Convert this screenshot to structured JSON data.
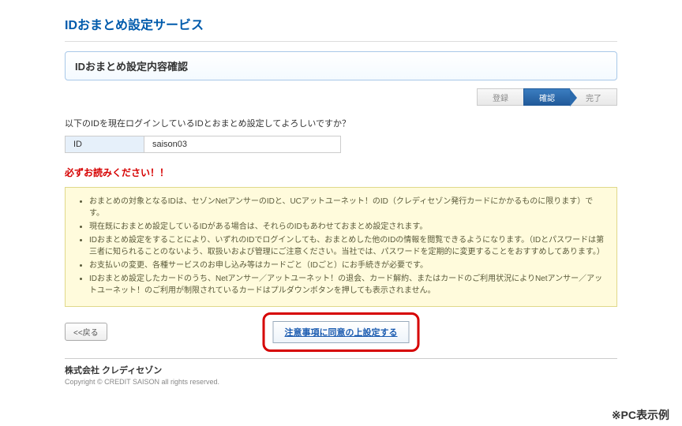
{
  "service_title": "IDおまとめ設定サービス",
  "panel_title": "IDおまとめ設定内容確認",
  "steps": {
    "s1": "登録",
    "s2": "確認",
    "s3": "完了"
  },
  "intro": "以下のIDを現在ログインしているIDとおまとめ設定してよろしいですか？",
  "id_section": {
    "label": "ID",
    "value": "saison03"
  },
  "warning": "必ずお読みください！！",
  "notices": [
    "おまとめの対象となるIDは、セゾンNetアンサーのIDと、UCアットユーネット！のID（クレディセゾン発行カードにかかるものに限ります）です。",
    "現在既におまとめ設定しているIDがある場合は、それらのIDもあわせておまとめ設定されます。",
    "IDおまとめ設定をすることにより、いずれのIDでログインしても、おまとめした他のIDの情報を閲覧できるようになります。（IDとパスワードは第三者に知られることのないよう、取扱いおよび管理にご注意ください。当社では、パスワードを定期的に変更することをおすすめしてあります。）",
    "お支払いの変更、各種サービスのお申し込み等はカードごと（IDごと）にお手続きが必要です。",
    "IDおまとめ設定したカードのうち、Netアンサー／アットユーネット！の退会、カード解約、またはカードのご利用状況によりNetアンサー／アットユーネット！のご利用が制限されているカードはプルダウンボタンを押しても表示されません。"
  ],
  "back_label": "<<戻る",
  "agree_label": "注意事項に同意の上設定する",
  "footer": {
    "company": "株式会社 クレディセゾン",
    "copyright": "Copyright © CREDIT SAISON all rights reserved."
  },
  "annotation": "※PC表示例"
}
